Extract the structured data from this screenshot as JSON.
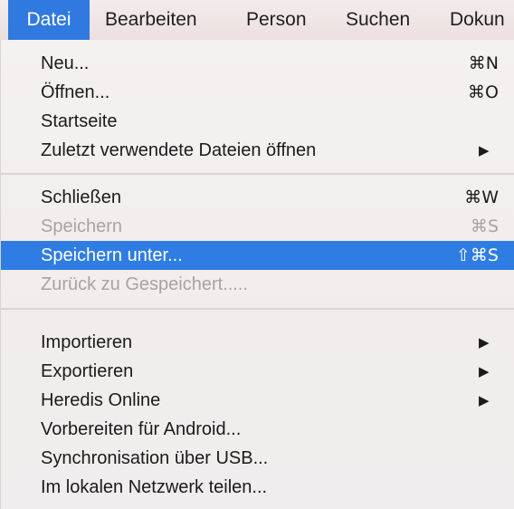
{
  "menubar": {
    "items": [
      {
        "label": "Datei"
      },
      {
        "label": "Bearbeiten"
      },
      {
        "label": "Person"
      },
      {
        "label": "Suchen"
      },
      {
        "label": "Dokun"
      }
    ]
  },
  "menu": {
    "items": [
      {
        "label": "Neu...",
        "shortcut": "⌘N"
      },
      {
        "label": "Öffnen...",
        "shortcut": "⌘O"
      },
      {
        "label": "Startseite"
      },
      {
        "label": "Zuletzt verwendete Dateien öffnen",
        "submenu_icon": "submenu-arrow-icon"
      },
      {
        "label": "Schließen",
        "shortcut": "⌘W"
      },
      {
        "label": "Speichern",
        "shortcut": "⌘S",
        "disabled": true
      },
      {
        "label": "Speichern unter...",
        "shortcut": "⇧⌘S",
        "highlighted": true
      },
      {
        "label": "Zurück zu Gespeichert.....",
        "disabled": true
      },
      {
        "label": "Importieren",
        "submenu_icon": "submenu-arrow-icon"
      },
      {
        "label": "Exportieren",
        "submenu_icon": "submenu-arrow-icon"
      },
      {
        "label": "Heredis Online",
        "submenu_icon": "submenu-arrow-icon"
      },
      {
        "label": "Vorbereiten für Android..."
      },
      {
        "label": "Synchronisation über USB..."
      },
      {
        "label": "Im lokalen Netzwerk teilen..."
      }
    ],
    "arrow_glyph": "▶"
  },
  "colors": {
    "highlight": "#2f7de3",
    "disabled_text": "#a7a4a4",
    "menu_background": "#f1eded"
  }
}
